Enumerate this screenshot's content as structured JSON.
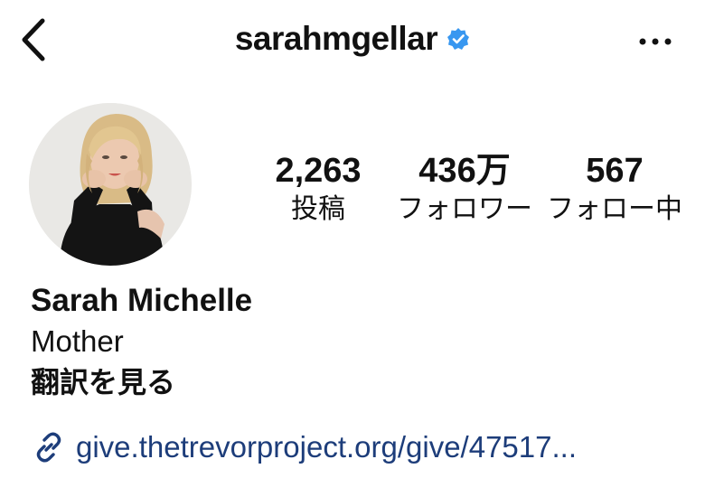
{
  "header": {
    "username": "sarahmgellar",
    "back_icon": "chevron-left-icon",
    "verified_icon": "verified-badge-icon",
    "more_icon": "more-horizontal-icon"
  },
  "stats": [
    {
      "value": "2,263",
      "label": "投稿"
    },
    {
      "value": "436万",
      "label": "フォロワー"
    },
    {
      "value": "567",
      "label": "フォロー中"
    }
  ],
  "bio": {
    "name": "Sarah Michelle",
    "text": "Mother",
    "translate_label": "翻訳を見る"
  },
  "link": {
    "icon": "link-icon",
    "text": "give.thetrevorproject.org/give/47517..."
  },
  "colors": {
    "text": "#111111",
    "verified": "#3897f0",
    "link": "#1d3d7a",
    "background": "#ffffff"
  }
}
